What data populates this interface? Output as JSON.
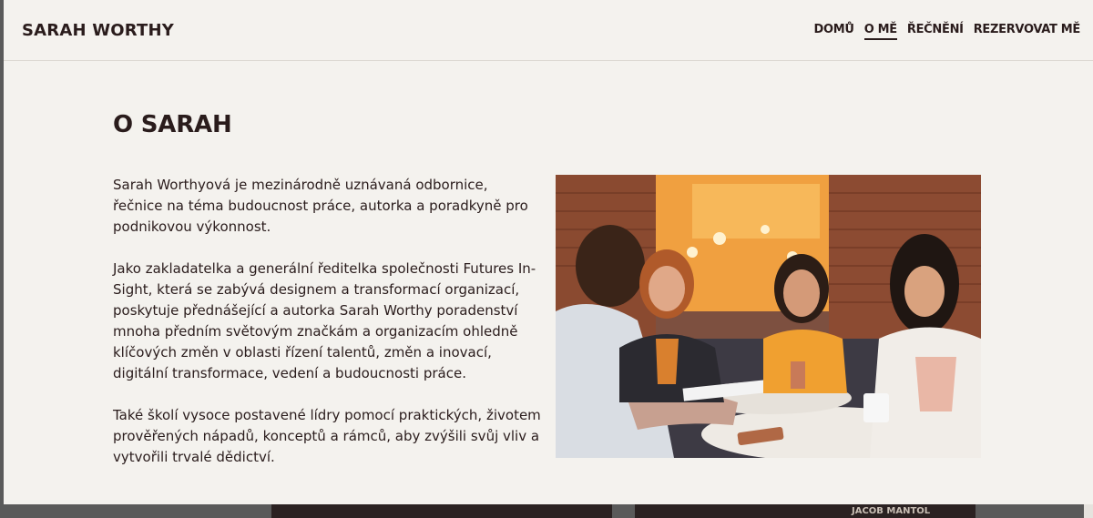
{
  "header": {
    "brand": "SARAH WORTHY",
    "nav": [
      {
        "label": "DOMŮ",
        "active": false
      },
      {
        "label": "O MĚ",
        "active": true
      },
      {
        "label": "ŘEČNĚNÍ",
        "active": false
      },
      {
        "label": "REZERVOVAT MĚ",
        "active": false
      }
    ]
  },
  "main": {
    "title": "O SARAH",
    "paragraphs": [
      "Sarah Worthyová je mezinárodně uznávaná odbornice, řečnice na téma budoucnost práce, autorka a poradkyně pro podnikovou výkonnost.",
      "Jako zakladatelka a generální ředitelka společnosti Futures In-Sight, která se zabývá designem a transformací organizací, poskytuje přednášející a autorka Sarah Worthy poradenství mnoha předním světovým značkám a organizacím ohledně klíčových změn v oblasti řízení talentů, změn a inovací, digitální transformace, vedení a budoucnosti práce.",
      "Také školí vysoce postavené lídry pomocí praktických, životem prověřených nápadů, konceptů a rámců, aby zvýšili svůj vliv a vytvořili trvalé dědictví."
    ]
  },
  "footer_peek": {
    "label": "JACOB MANTOL"
  },
  "colors": {
    "text": "#2a1c1c",
    "page_bg": "#f4f2ee",
    "photo_accent": "#e8953a"
  }
}
